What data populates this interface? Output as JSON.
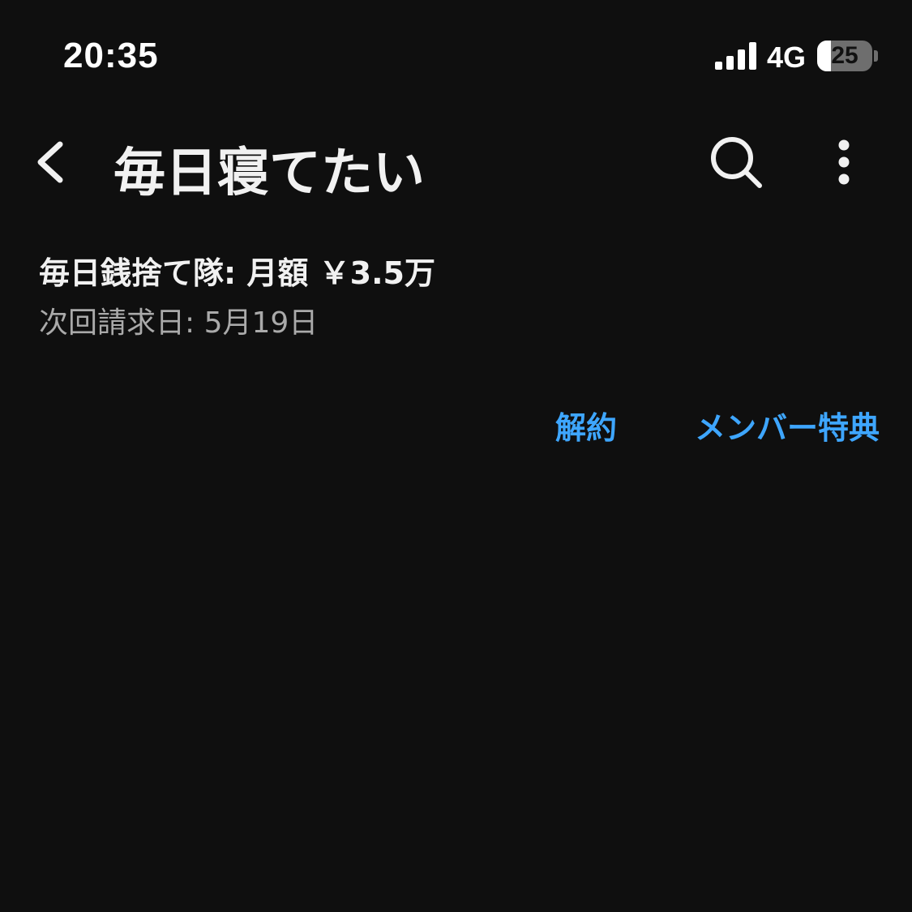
{
  "status_bar": {
    "time": "20:35",
    "network": "4G",
    "battery_level": "25",
    "battery_fraction": 0.25,
    "signal_icon": "cellular-signal-icon",
    "battery_icon": "battery-icon"
  },
  "header": {
    "title": "毎日寝てたい",
    "back_icon": "chevron-left-icon",
    "search_icon": "search-icon",
    "more_icon": "more-vertical-icon"
  },
  "membership": {
    "plan_label": "毎日銭捨て隊: 月額 ￥3.5万",
    "next_billing_label": "次回請求日: 5月19日"
  },
  "actions": {
    "cancel_label": "解約",
    "perks_label": "メンバー特典"
  },
  "colors": {
    "background": "#0f0f0f",
    "text_primary": "#f1f1f1",
    "text_secondary": "#aaaaaa",
    "accent_link": "#3ea6ff"
  }
}
